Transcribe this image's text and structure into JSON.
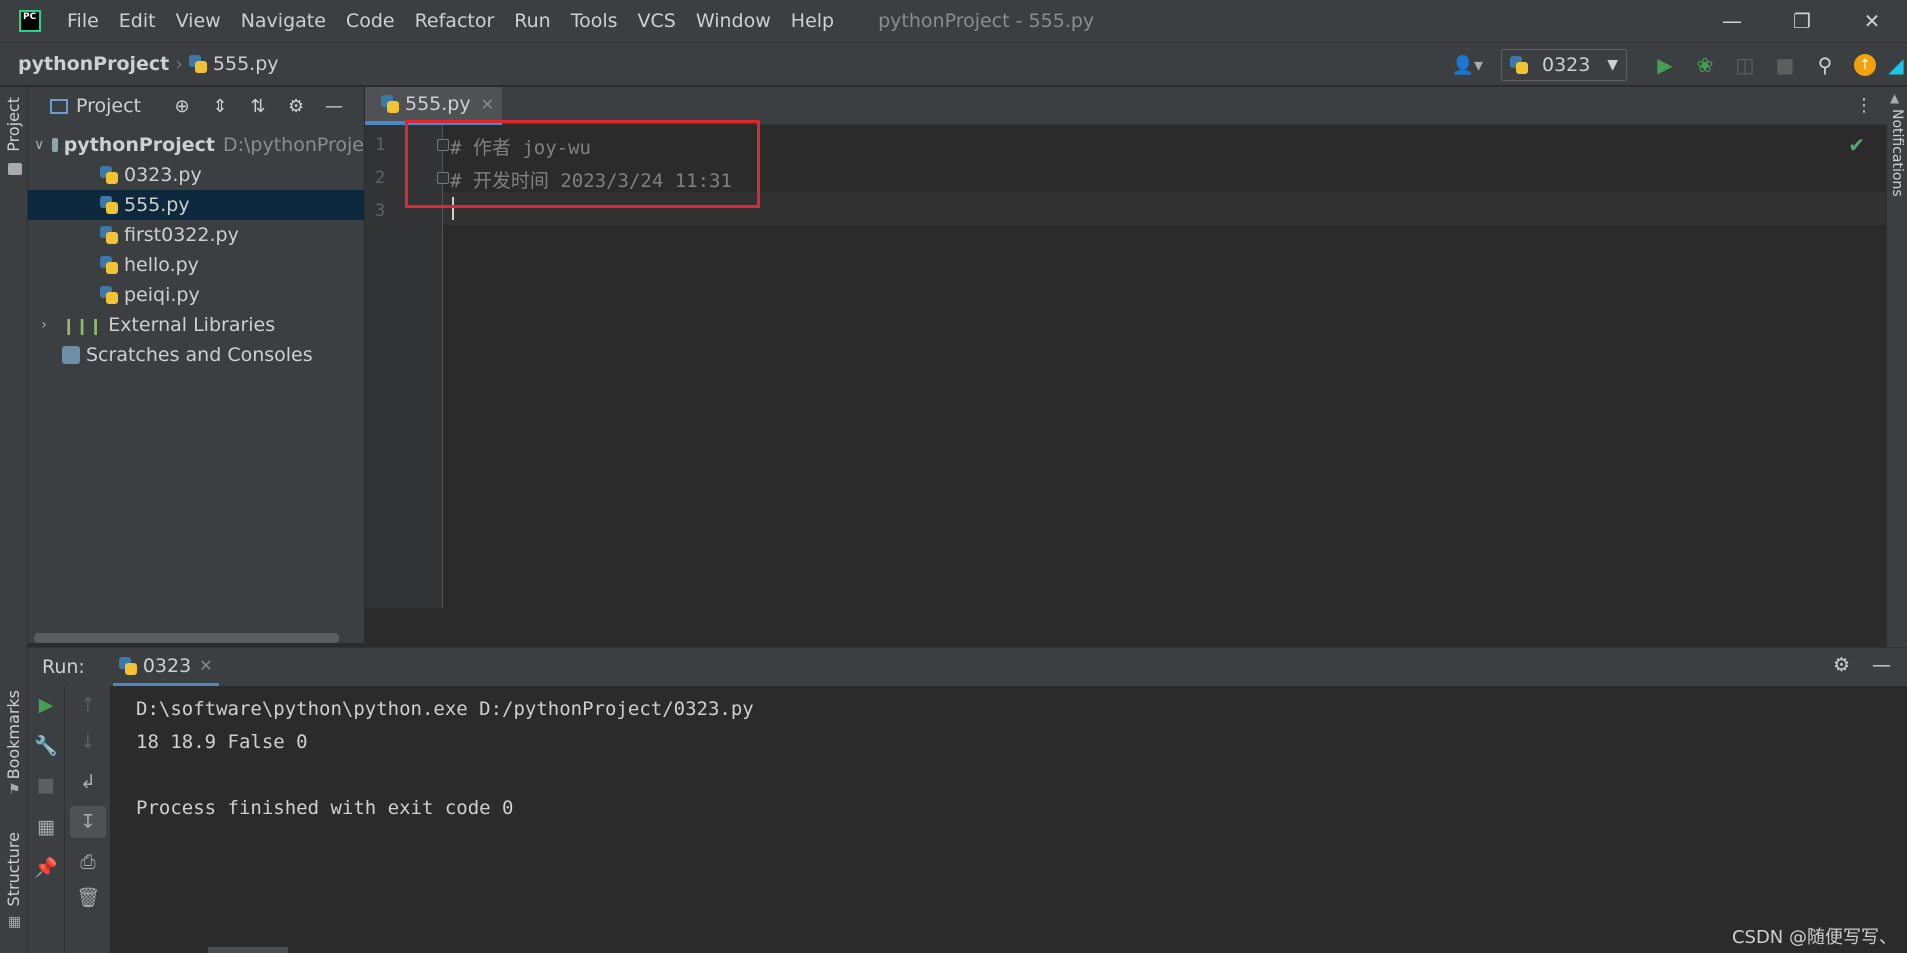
{
  "app": {
    "window_title": "pythonProject - 555.py",
    "menu": [
      "File",
      "Edit",
      "View",
      "Navigate",
      "Code",
      "Refactor",
      "Run",
      "Tools",
      "VCS",
      "Window",
      "Help"
    ]
  },
  "navbar": {
    "project": "pythonProject",
    "file": "555.py",
    "run_config": "0323"
  },
  "left_stripe": {
    "project_tab": "Project",
    "bookmarks_tab": "Bookmarks",
    "structure_tab": "Structure"
  },
  "right_stripe": {
    "notifications_tab": "Notifications"
  },
  "project_panel": {
    "title": "Project",
    "root": {
      "name": "pythonProject",
      "path": "D:\\pythonProje"
    },
    "files": [
      "0323.py",
      "555.py",
      "first0322.py",
      "hello.py",
      "peiqi.py"
    ],
    "selected_file": "555.py",
    "external_libraries": "External Libraries",
    "scratches": "Scratches and Consoles"
  },
  "editor": {
    "tab_label": "555.py",
    "line_numbers": [
      "1",
      "2",
      "3"
    ],
    "lines": [
      "# 作者 joy-wu",
      "# 开发时间 2023/3/24 11:31",
      ""
    ]
  },
  "run_panel": {
    "label": "Run:",
    "tab_label": "0323",
    "console": [
      "D:\\software\\python\\python.exe D:/pythonProject/0323.py",
      "18 18.9 False 0",
      "",
      "Process finished with exit code 0"
    ]
  },
  "watermark": "CSDN @随便写写、",
  "colors": {
    "accent": "#4a88c7",
    "highlight_box": "#e0262e",
    "selection": "#0d293e",
    "run_green": "#499c54"
  }
}
